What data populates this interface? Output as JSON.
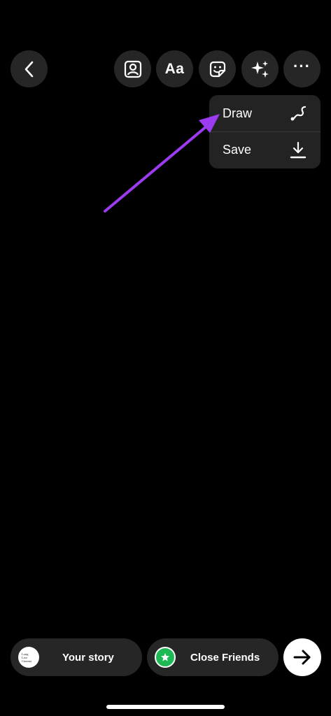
{
  "toolbar": {
    "back_icon": "chevron-left-icon",
    "tag_icon": "person-tag-icon",
    "text_tool_label": "Aa",
    "sticker_icon": "sticker-icon",
    "effects_icon": "sparkles-icon",
    "more_label": "···"
  },
  "menu": {
    "items": [
      {
        "label": "Draw",
        "icon": "squiggle-pen-icon"
      },
      {
        "label": "Save",
        "icon": "download-icon"
      }
    ]
  },
  "annotation": {
    "arrow_color": "#9b3cf0"
  },
  "share": {
    "your_story": {
      "label": "Your story",
      "avatar_text": [
        "Long",
        "Live",
        "Cinema"
      ]
    },
    "close_friends": {
      "label": "Close Friends",
      "badge_color": "#1db954"
    },
    "next_icon": "arrow-right-icon"
  },
  "colors": {
    "background": "#000000",
    "button_bg": "#262626",
    "menu_bg": "#232323"
  }
}
